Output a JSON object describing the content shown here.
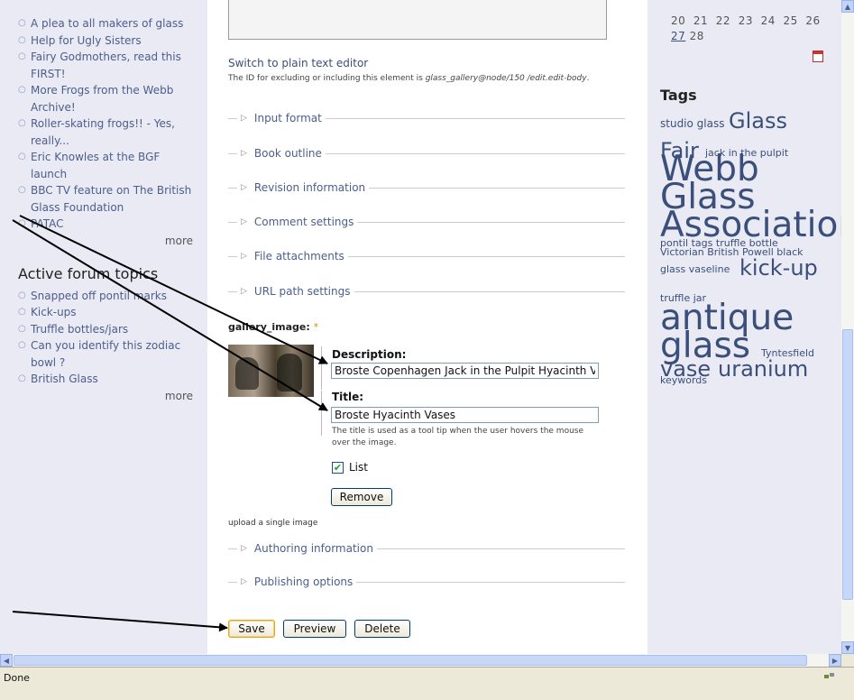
{
  "left_sidebar": {
    "recent_items": [
      "A plea to all makers of glass",
      "Help for Ugly Sisters",
      "Fairy Godmothers, read this FIRST!",
      "More Frogs from the Webb Archive!",
      "Roller-skating frogs!! - Yes, really...",
      "Eric Knowles at the BGF launch",
      "BBC TV feature on The British Glass Foundation",
      "PATAC"
    ],
    "more_label": "more",
    "forum_title": "Active forum topics",
    "forum_items": [
      "Snapped off pontil marks",
      "Kick-ups",
      "Truffle bottles/jars",
      "Can you identify this zodiac bowl ?",
      "British Glass"
    ],
    "forum_more_label": "more"
  },
  "main": {
    "switch_editor_label": "Switch to plain text editor",
    "id_help_prefix": "The ID for excluding or including this element is ",
    "id_help_code": "glass_gallery@node/150 /edit.edit-body",
    "id_help_suffix": ".",
    "fieldsets": [
      "Input format",
      "Book outline",
      "Revision information",
      "Comment settings",
      "File attachments",
      "URL path settings"
    ],
    "gallery_label": "gallery_image:",
    "required_mark": "*",
    "description_label": "Description:",
    "description_value": "Broste Copenhagen Jack in the Pulpit Hyacinth Va",
    "title_label": "Title:",
    "title_value": "Broste Hyacinth Vases",
    "title_help": "The title is used as a tool tip when the user hovers the mouse over the image.",
    "list_label": "List",
    "list_checked": true,
    "remove_label": "Remove",
    "upload_text": "upload a single image",
    "fieldsets_bottom": [
      "Authoring information",
      "Publishing options"
    ],
    "save_label": "Save",
    "preview_label": "Preview",
    "delete_label": "Delete"
  },
  "right_sidebar": {
    "calendar_row1": "20  21  22  23  24  25  26",
    "calendar_link": "27",
    "calendar_rest": " 28",
    "tags_title": "Tags",
    "tags": {
      "studio_glass": "studio glass",
      "glass_big": "Glass",
      "fair": "Fair",
      "jack": "jack in the pulpit",
      "webb": "Webb",
      "glass2": "Glass",
      "association": "Association",
      "pontil": "pontil",
      "tags_word": "tags",
      "truffle": "truffle",
      "bottle": "bottle",
      "victorian": "Victorian",
      "british": "British",
      "powell": "Powell",
      "black": "black",
      "glass_small": "glass",
      "vaseline": "vaseline",
      "kickup": "kick-up",
      "truffle_jar": "truffle jar",
      "antique": "antique",
      "glass3": "glass",
      "tyntesfield": "Tyntesfield",
      "vase": "vase",
      "uranium": "uranium",
      "keywords": "keywords"
    }
  },
  "status_bar": {
    "text": "Done"
  },
  "colors": {
    "sidebar_bg": "#eaeaf4",
    "link": "#3a4f7a",
    "tag": "#3a4f7a",
    "required": "#e08a00"
  }
}
